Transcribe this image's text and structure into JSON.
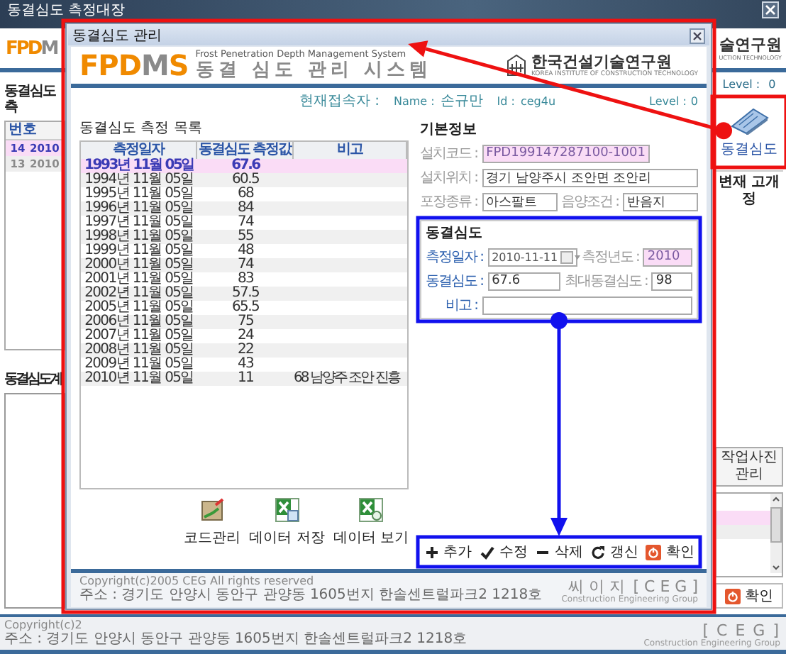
{
  "main_window": {
    "title": "동결심도 측정대장",
    "logo": "FPDM",
    "org_name": "술연구원",
    "org_subtitle": "UCTION TECHNOLOGY",
    "level_label": "Level :",
    "level_value": "0",
    "list_title": "동결심도 측",
    "columns": [
      "번호"
    ],
    "rows": [
      {
        "cells": [
          "14",
          "2010"
        ],
        "selected": true
      },
      {
        "cells": [
          "13",
          "2010"
        ],
        "selected": false
      }
    ],
    "gauge_title": "동결심도계",
    "side_button": "동결심도",
    "side_label": "변재 고개 정",
    "photo_tab": "작업사진관리",
    "ok_button": "확인",
    "ceg_logo": "[ C E G ]",
    "ceg_subtitle": "Construction Engineering Group",
    "copyright": "Copyright(c)2",
    "address": "주소 : 경기도 안양시 동안구 관양동 1605번지 한솔센트럴파크2 1218호"
  },
  "dialog": {
    "title": "동결심도 관리",
    "logo": "FPDMS",
    "subtitle_en": "Frost Penetration Depth Management System",
    "subtitle_ko": "동결 심도 관리 시스템",
    "org_name": "한국건설기술연구원",
    "org_subtitle": "KOREA INSTITUTE OF CONSTRUCTION TECHNOLOGY",
    "user": {
      "caption": "현재접속자 :",
      "name_label": "Name :",
      "name": "손규만",
      "id_label": "Id :",
      "id": "ceg4u",
      "level_label": "Level :",
      "level_value": "0"
    },
    "measure_list": {
      "title": "동결심도 측정 목록",
      "columns": [
        "측정일자",
        "동결심도 측정값",
        "비고"
      ],
      "rows": [
        {
          "date": "1993년 11월 05일",
          "value": "67.6",
          "selected": true
        },
        {
          "date": "1994년 11월 05일",
          "value": "60.5",
          "selected": false
        },
        {
          "date": "1995년 11월 05일",
          "value": "68",
          "selected": false
        },
        {
          "date": "1996년 11월 05일",
          "value": "84",
          "selected": false
        },
        {
          "date": "1997년 11월 05일",
          "value": "74",
          "selected": false
        },
        {
          "date": "1998년 11월 05일",
          "value": "55",
          "selected": false
        },
        {
          "date": "1999년 11월 05일",
          "value": "48",
          "selected": false
        },
        {
          "date": "2000년 11월 05일",
          "value": "74",
          "selected": false
        },
        {
          "date": "2001년 11월 05일",
          "value": "83",
          "selected": false
        },
        {
          "date": "2002년 11월 05일",
          "value": "57.5",
          "selected": false
        },
        {
          "date": "2005년 11월 05일",
          "value": "65.5",
          "selected": false
        },
        {
          "date": "2006년 11월 05일",
          "value": "75",
          "selected": false
        },
        {
          "date": "2007년 11월 05일",
          "value": "24",
          "selected": false
        },
        {
          "date": "2008년 11월 05일",
          "value": "22",
          "selected": false
        },
        {
          "date": "2009년 11월 05일",
          "value": "43",
          "selected": false
        },
        {
          "date": "2010년 11월 05일",
          "value": "11",
          "note": "68 남양주 조안 진흥",
          "selected": false
        }
      ]
    },
    "tools": [
      {
        "label": "코드관리",
        "kind": "code"
      },
      {
        "label": "데이터 저장",
        "kind": "excel-save"
      },
      {
        "label": "데이터 보기",
        "kind": "excel-view"
      }
    ],
    "basic_info": {
      "title": "기본정보",
      "fields": [
        {
          "label": "설치코드 :",
          "value": "FPD199147287100-1001",
          "editable": false,
          "highlighted": true
        },
        {
          "label": "설치위치 :",
          "value": "경기 남양주시 조안면 조안리",
          "editable": false,
          "highlighted": false
        },
        {
          "label": "포장종류 :",
          "value": "아스팔트",
          "editable": false,
          "highlighted": false
        },
        {
          "label": "음양조건 :",
          "value": "반음지",
          "editable": false,
          "highlighted": false
        }
      ]
    },
    "frost_depth": {
      "title": "동결심도",
      "fields": [
        {
          "label": "측정일자 :",
          "value": "2010-11-11",
          "kind": "date",
          "editable": true,
          "highlighted": false
        },
        {
          "label": "측정년도 :",
          "value": "2010",
          "kind": "text",
          "editable": false,
          "highlighted": true
        },
        {
          "label": "동결심도 :",
          "value": "67.6",
          "kind": "text",
          "editable": true,
          "highlighted": false
        },
        {
          "label": "최대동결심도 :",
          "value": "98",
          "kind": "text",
          "editable": false,
          "highlighted": false
        },
        {
          "label": "비고 :",
          "kind": "text",
          "editable": true,
          "highlighted": false
        }
      ]
    },
    "actions": [
      {
        "label": "추가",
        "kind": "add"
      },
      {
        "label": "수정",
        "kind": "edit"
      },
      {
        "label": "삭제",
        "kind": "delete"
      },
      {
        "label": "갱신",
        "kind": "refresh"
      },
      {
        "label": "확인",
        "kind": "ok"
      }
    ],
    "copyright": "Copyright(c)2005 CEG All rights reserved",
    "address": "주소 : 경기도 안양시 동안구 관양동 1605번지 한솔센트럴파크2 1218호",
    "ceg_ko": "씨 이 지",
    "ceg_logo": "[ C E G ]",
    "ceg_subtitle": "Construction Engineering Group"
  }
}
